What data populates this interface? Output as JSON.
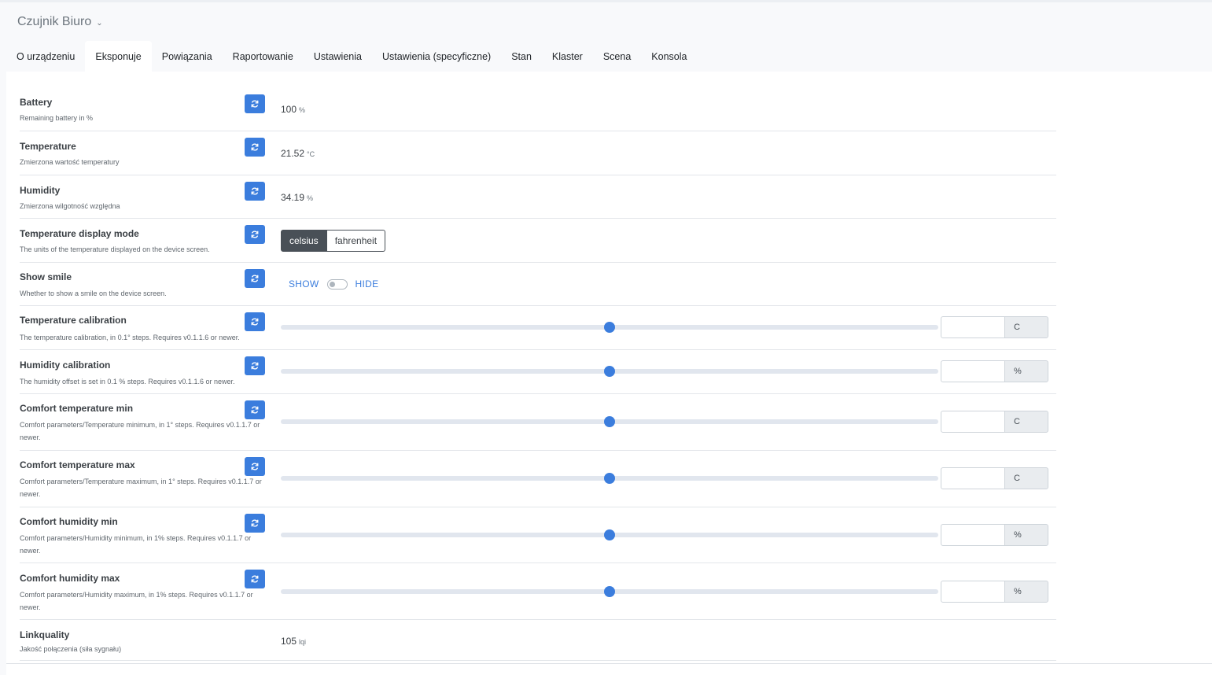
{
  "device": {
    "title": "Czujnik Biuro"
  },
  "tabs": [
    {
      "label": "O urządzeniu",
      "active": false
    },
    {
      "label": "Eksponuje",
      "active": true
    },
    {
      "label": "Powiązania",
      "active": false
    },
    {
      "label": "Raportowanie",
      "active": false
    },
    {
      "label": "Ustawienia",
      "active": false
    },
    {
      "label": "Ustawienia (specyficzne)",
      "active": false
    },
    {
      "label": "Stan",
      "active": false
    },
    {
      "label": "Klaster",
      "active": false
    },
    {
      "label": "Scena",
      "active": false
    },
    {
      "label": "Konsola",
      "active": false
    }
  ],
  "exposes": {
    "battery": {
      "label": "Battery",
      "desc": "Remaining battery in %",
      "value": "100",
      "unit": "%"
    },
    "temperature": {
      "label": "Temperature",
      "desc": "Zmierzona wartość temperatury",
      "value": "21.52",
      "unit": "°C"
    },
    "humidity": {
      "label": "Humidity",
      "desc": "Zmierzona wilgotność względna",
      "value": "34.19",
      "unit": "%"
    },
    "temp_display_mode": {
      "label": "Temperature display mode",
      "desc": "The units of the temperature displayed on the device screen.",
      "options": [
        "celsius",
        "fahrenheit"
      ],
      "selected": "celsius"
    },
    "show_smile": {
      "label": "Show smile",
      "desc": "Whether to show a smile on the device screen.",
      "on_label": "SHOW",
      "off_label": "HIDE"
    },
    "temperature_calibration": {
      "label": "Temperature calibration",
      "desc": "The temperature calibration, in 0.1° steps. Requires v0.1.1.6 or newer.",
      "unit": "C",
      "slider_fraction": 0.5,
      "value": ""
    },
    "humidity_calibration": {
      "label": "Humidity calibration",
      "desc": "The humidity offset is set in 0.1 % steps. Requires v0.1.1.6 or newer.",
      "unit": "%",
      "slider_fraction": 0.5,
      "value": ""
    },
    "comfort_temperature_min": {
      "label": "Comfort temperature min",
      "desc": "Comfort parameters/Temperature minimum, in 1° steps. Requires v0.1.1.7 or newer.",
      "unit": "C",
      "slider_fraction": 0.5,
      "value": ""
    },
    "comfort_temperature_max": {
      "label": "Comfort temperature max",
      "desc": "Comfort parameters/Temperature maximum, in 1° steps. Requires v0.1.1.7 or newer.",
      "unit": "C",
      "slider_fraction": 0.5,
      "value": ""
    },
    "comfort_humidity_min": {
      "label": "Comfort humidity min",
      "desc": "Comfort parameters/Humidity minimum, in 1% steps. Requires v0.1.1.7 or newer.",
      "unit": "%",
      "slider_fraction": 0.5,
      "value": ""
    },
    "comfort_humidity_max": {
      "label": "Comfort humidity max",
      "desc": "Comfort parameters/Humidity maximum, in 1% steps. Requires v0.1.1.7 or newer.",
      "unit": "%",
      "slider_fraction": 0.5,
      "value": ""
    },
    "linkquality": {
      "label": "Linkquality",
      "desc": "Jakość połączenia (siła sygnału)",
      "value": "105",
      "unit": "lqi"
    }
  },
  "icons": {
    "refresh": "refresh-icon",
    "chevron": "chevron-down-icon"
  },
  "colors": {
    "accent": "#3b7ddd",
    "dark": "#495057"
  }
}
